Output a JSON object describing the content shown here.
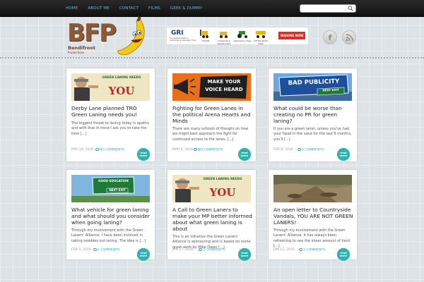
{
  "nav": {
    "items": [
      "HOME",
      "ABOUT ME",
      "CONTACT",
      "FILMS",
      "GEEK & DUMMY"
    ],
    "search_placeholder": "",
    "accent": "#56c3c9"
  },
  "header": {
    "logo_letters": "BFP",
    "logo_name": "Bendifroot",
    "logo_tagline": "Productions",
    "ad": {
      "brand": "GRI",
      "brand_sub": "Guaranteed Return Industrial & Specialty Tires",
      "captions": [
        "Forklift",
        "Industrial & Construction",
        "Agriculture Tires",
        "Off The Road Tires"
      ],
      "cta": "INQUIRE NOW"
    },
    "social": {
      "facebook": "f",
      "rss": "rss"
    }
  },
  "readmore_label": "read more",
  "posts": [
    {
      "title": "Derby Lane planned TRO Green Laning needs you!",
      "excerpt": "The biggest threat to laning today is apathy and with that in mind I ask you to take the time [...]",
      "date": "MAY 24, 2016",
      "comments": "NO COMMENTS",
      "thumb": {
        "kind": "poster",
        "line1": "GREEN LANING NEEDS",
        "line2": "YOU"
      }
    },
    {
      "title": "Fighting for Green Lanes in the political Arena  Hearts and Minds",
      "excerpt": "There are many schools of thought on how we might best approach the fight for continued access to the lanes. [...]",
      "date": "MAR 9, 2016",
      "comments": "NO COMMENTS",
      "thumb": {
        "kind": "megaphone",
        "line1": "MAKE YOUR",
        "line2": "VOICE HEARD"
      }
    },
    {
      "title": "What could be worse than creating no PR for green laning?",
      "excerpt": "If you are a green laner, unless you've had your head in the sand for the last 6 months, you'll [...]",
      "date": "FEB 8, 2016",
      "comments": "4 COMMENTS",
      "thumb": {
        "kind": "sign",
        "line1": "BAD PUBLICITY",
        "line2": "NEXT EXIT"
      }
    },
    {
      "title": "What vehicle for green laning and what should you consider when going laning?",
      "excerpt": "Through my involvement with the Green Laners' Alliance, I have been involved in taking newbies out laning. The idea is [...]",
      "date": "FEB 3, 2016",
      "comments": "2 COMMENTS",
      "thumb": {
        "kind": "greensign",
        "line1": "GOOD EDUCATION",
        "line2": "NEXT EXIT"
      }
    },
    {
      "title": "A Call to Green Laners to make your MP better informed about what green laning is about",
      "excerpt": "This is an initiative the Green Laners' Alliance is sponsoring and is based on some great work by Mike Owen [...]",
      "date": "JAN 17, 2016",
      "comments": "3 COMMENTS",
      "thumb": {
        "kind": "poster",
        "line1": "GREEN LANING NEEDS",
        "line2": "YOU"
      }
    },
    {
      "title": "An open letter to Countryside Vandals, YOU ARE NOT GREEN LANERS!",
      "excerpt": "Through my involvement with the Green Laners' Alliance, it has always been refreshing to see the sheer amount of hard [...]",
      "date": "JAN 12, 2016",
      "comments": "3 COMMENTS",
      "thumb": {
        "kind": "lane"
      }
    }
  ]
}
